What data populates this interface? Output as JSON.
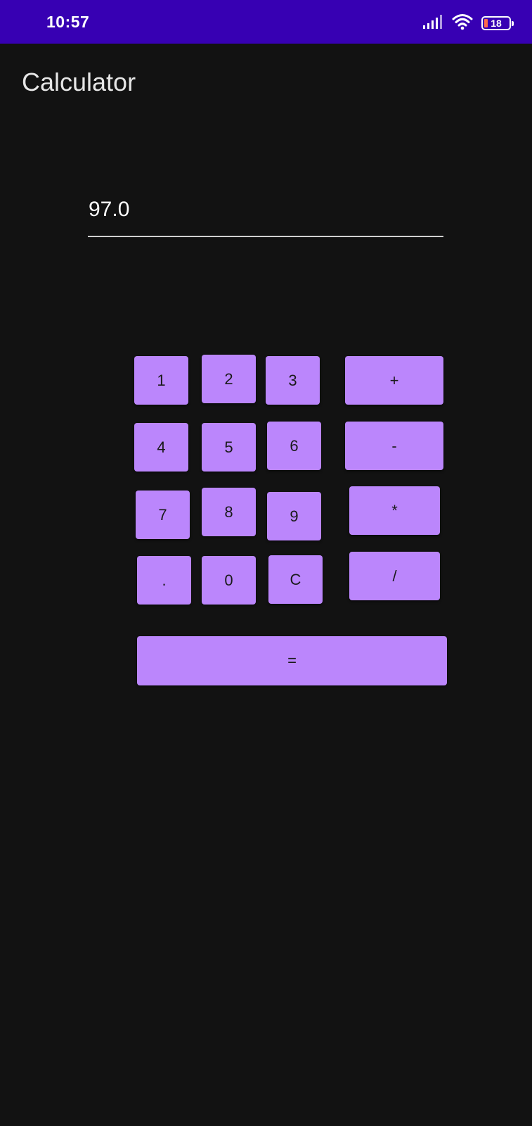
{
  "status_bar": {
    "time": "10:57",
    "battery_level": "18",
    "color": "#3700b3"
  },
  "app": {
    "title": "Calculator"
  },
  "display": {
    "value": "97.0"
  },
  "keypad": {
    "one": "1",
    "two": "2",
    "three": "3",
    "plus": "+",
    "four": "4",
    "five": "5",
    "six": "6",
    "minus": "-",
    "seven": "7",
    "eight": "8",
    "nine": "9",
    "multiply": "*",
    "dot": ".",
    "zero": "0",
    "clear": "C",
    "divide": "/",
    "equals": "="
  },
  "colors": {
    "background": "#121212",
    "button": "#bb86fc",
    "status_bar": "#3700b3"
  }
}
